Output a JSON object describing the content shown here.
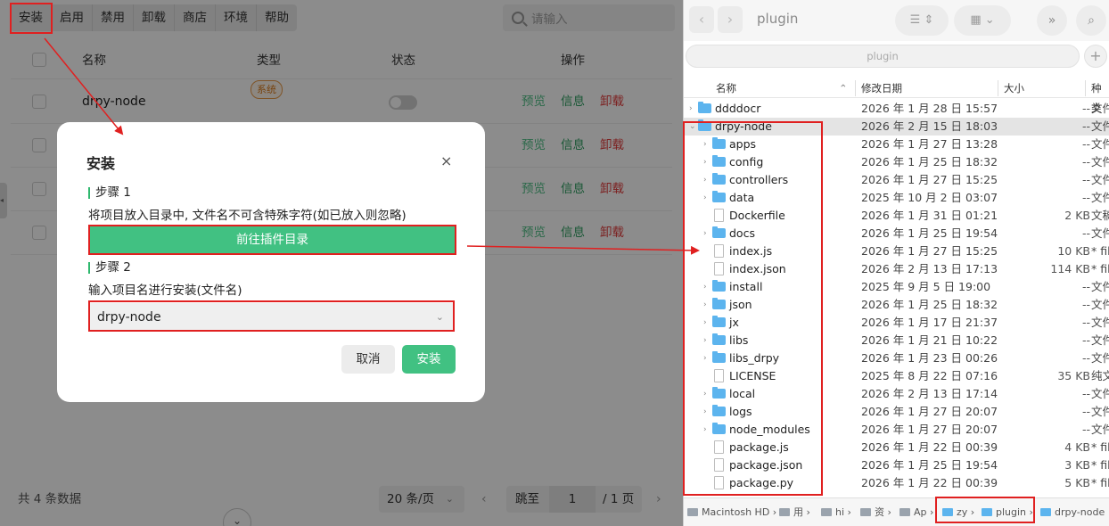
{
  "left": {
    "toolbar": [
      "安装",
      "启用",
      "禁用",
      "卸载",
      "商店",
      "环境",
      "帮助"
    ],
    "search_placeholder": "请输入",
    "columns": {
      "name": "名称",
      "type": "类型",
      "status": "状态",
      "actions": "操作"
    },
    "rows": [
      {
        "name": "drpy-node",
        "tag": "系统",
        "preview": "预览",
        "info": "信息",
        "uninstall": "卸载"
      },
      {
        "preview": "预览",
        "info": "信息",
        "uninstall": "卸载"
      },
      {
        "preview": "预览",
        "info": "信息",
        "uninstall": "卸载"
      },
      {
        "preview": "预览",
        "info": "信息",
        "uninstall": "卸载"
      }
    ],
    "footer": {
      "total": "共 4 条数据",
      "page_size": "20 条/页",
      "jump_label": "跳至",
      "page": "1",
      "total_pages": "/ 1 页"
    }
  },
  "modal": {
    "title": "安装",
    "close": "×",
    "step1_title": "步骤 1",
    "step1_desc": "将项目放入目录中, 文件名不可含特殊字符(如已放入则忽略)",
    "go_button": "前往插件目录",
    "step2_title": "步骤 2",
    "step2_desc": "输入项目名进行安装(文件名)",
    "select_value": "drpy-node",
    "cancel": "取消",
    "confirm": "安装"
  },
  "finder": {
    "title": "plugin",
    "path_bar": "plugin",
    "columns": {
      "name": "名称",
      "date": "修改日期",
      "size": "大小",
      "kind": "种类"
    },
    "rows": [
      {
        "name": "ddddocr",
        "date": "2026 年 1 月 28 日 15:57",
        "size": "--",
        "kind": "文件",
        "folder": true,
        "disc": "›",
        "indent": 0
      },
      {
        "name": "drpy-node",
        "date": "2026 年 2 月 15 日 18:03",
        "size": "--",
        "kind": "文件",
        "folder": true,
        "disc": "⌄",
        "indent": 0,
        "selected": true
      },
      {
        "name": "apps",
        "date": "2026 年 1 月 27 日 13:28",
        "size": "--",
        "kind": "文件",
        "folder": true,
        "disc": "›",
        "indent": 1
      },
      {
        "name": "config",
        "date": "2026 年 1 月 25 日 18:32",
        "size": "--",
        "kind": "文件",
        "folder": true,
        "disc": "›",
        "indent": 1
      },
      {
        "name": "controllers",
        "date": "2026 年 1 月 27 日 15:25",
        "size": "--",
        "kind": "文件",
        "folder": true,
        "disc": "›",
        "indent": 1
      },
      {
        "name": "data",
        "date": "2025 年 10 月 2 日 03:07",
        "size": "--",
        "kind": "文件",
        "folder": true,
        "disc": "›",
        "indent": 1
      },
      {
        "name": "Dockerfile",
        "date": "2026 年 1 月 31 日 01:21",
        "size": "2 KB",
        "kind": "文稿",
        "folder": false,
        "disc": "",
        "indent": 1
      },
      {
        "name": "docs",
        "date": "2026 年 1 月 25 日 19:54",
        "size": "--",
        "kind": "文件",
        "folder": true,
        "disc": "›",
        "indent": 1
      },
      {
        "name": "index.js",
        "date": "2026 年 1 月 27 日 15:25",
        "size": "10 KB",
        "kind": "* fil",
        "folder": false,
        "disc": "",
        "indent": 1
      },
      {
        "name": "index.json",
        "date": "2026 年 2 月 13 日 17:13",
        "size": "114 KB",
        "kind": "* fil",
        "folder": false,
        "disc": "",
        "indent": 1
      },
      {
        "name": "install",
        "date": "2025 年 9 月 5 日 19:00",
        "size": "--",
        "kind": "文件",
        "folder": true,
        "disc": "›",
        "indent": 1
      },
      {
        "name": "json",
        "date": "2026 年 1 月 25 日 18:32",
        "size": "--",
        "kind": "文件",
        "folder": true,
        "disc": "›",
        "indent": 1
      },
      {
        "name": "jx",
        "date": "2026 年 1 月 17 日 21:37",
        "size": "--",
        "kind": "文件",
        "folder": true,
        "disc": "›",
        "indent": 1
      },
      {
        "name": "libs",
        "date": "2026 年 1 月 21 日 10:22",
        "size": "--",
        "kind": "文件",
        "folder": true,
        "disc": "›",
        "indent": 1
      },
      {
        "name": "libs_drpy",
        "date": "2026 年 1 月 23 日 00:26",
        "size": "--",
        "kind": "文件",
        "folder": true,
        "disc": "›",
        "indent": 1
      },
      {
        "name": "LICENSE",
        "date": "2025 年 8 月 22 日 07:16",
        "size": "35 KB",
        "kind": "纯文",
        "folder": false,
        "disc": "",
        "indent": 1
      },
      {
        "name": "local",
        "date": "2026 年 2 月 13 日 17:14",
        "size": "--",
        "kind": "文件",
        "folder": true,
        "disc": "›",
        "indent": 1
      },
      {
        "name": "logs",
        "date": "2026 年 1 月 27 日 20:07",
        "size": "--",
        "kind": "文件",
        "folder": true,
        "disc": "›",
        "indent": 1
      },
      {
        "name": "node_modules",
        "date": "2026 年 1 月 27 日 20:07",
        "size": "--",
        "kind": "文件",
        "folder": true,
        "disc": "›",
        "indent": 1
      },
      {
        "name": "package.js",
        "date": "2026 年 1 月 22 日 00:39",
        "size": "4 KB",
        "kind": "* fil",
        "folder": false,
        "disc": "",
        "indent": 1
      },
      {
        "name": "package.json",
        "date": "2026 年 1 月 25 日 19:54",
        "size": "3 KB",
        "kind": "* fil",
        "folder": false,
        "disc": "",
        "indent": 1
      },
      {
        "name": "package.py",
        "date": "2026 年 1 月 22 日 00:39",
        "size": "5 KB",
        "kind": "* fil",
        "folder": false,
        "disc": "",
        "indent": 1
      }
    ],
    "breadcrumb": [
      "Macintosh HD",
      "用",
      "hi",
      "资",
      "Ap",
      "zy",
      "plugin",
      "drpy-node"
    ]
  },
  "colors": {
    "accent_green": "#41c182",
    "annotation_red": "#e02020",
    "danger": "#e23b3b",
    "finder_folder": "#5cb4ee"
  }
}
